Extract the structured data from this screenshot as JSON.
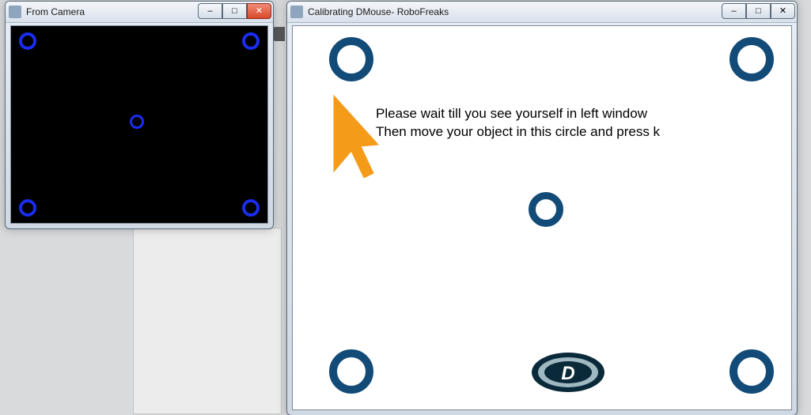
{
  "camera_window": {
    "title": "From Camera",
    "minimize_tip": "Minimize",
    "maximize_tip": "Maximize",
    "close_tip": "Close"
  },
  "calib_window": {
    "title": "Calibrating DMouse- RoboFreaks",
    "minimize_tip": "Minimize",
    "maximize_tip": "Maximize",
    "close_tip": "Close",
    "instruction_line1": "Please wait till you see yourself in left window",
    "instruction_line2": "Then move your object in this circle and press k",
    "logo_letter": "D"
  },
  "icons": {
    "minimize_glyph": "–",
    "maximize_glyph": "□",
    "close_glyph": "✕"
  }
}
